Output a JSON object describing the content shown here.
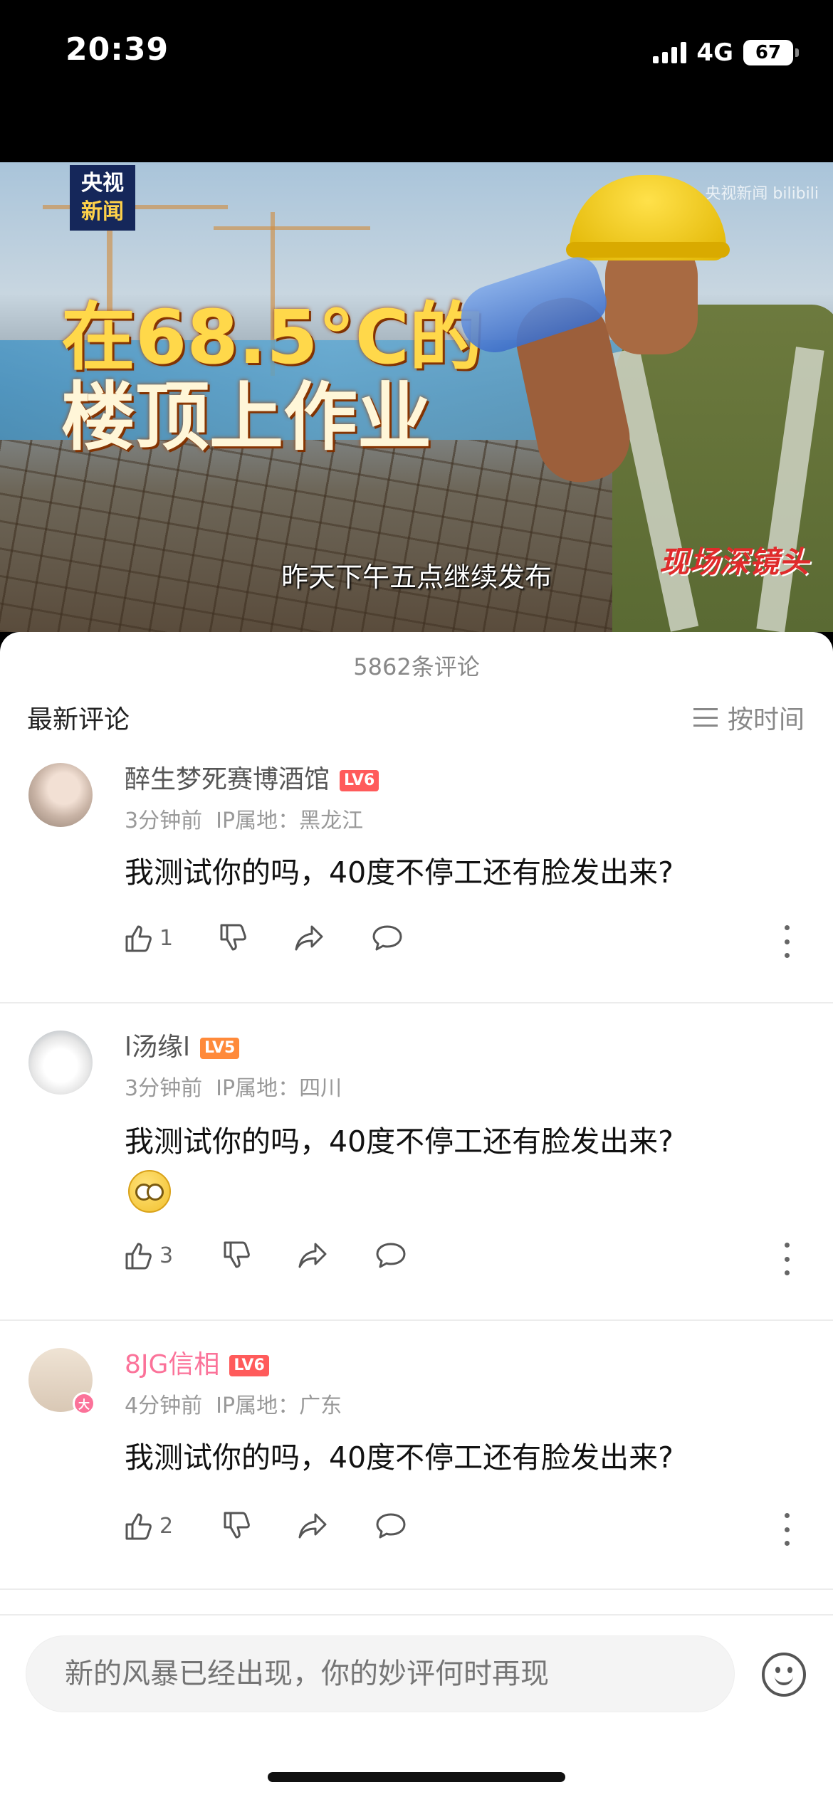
{
  "status_bar": {
    "time": "20:39",
    "network": "4G",
    "battery": "67"
  },
  "video": {
    "logo_line1": "央视",
    "logo_line2": "新闻",
    "watermark": "央视新闻 bilibili",
    "headline_line1": "在68.5°C的",
    "headline_line2": "楼顶上作业",
    "subtitle": "昨天下午五点继续发布",
    "corner_logo": "现场深镜头"
  },
  "comments_panel": {
    "count": "5862条评论",
    "section_title": "最新评论",
    "sort_label": "按时间"
  },
  "comments": [
    {
      "username": "醉生梦死赛博酒馆",
      "level": "LV6",
      "time": "3分钟前",
      "location": "IP属地：黑龙江",
      "text": "我测试你的吗，40度不停工还有脸发出来?",
      "likes": "1"
    },
    {
      "username": "l汤缘l",
      "level": "LV5",
      "time": "3分钟前",
      "location": "IP属地：四川",
      "text": "我测试你的吗，40度不停工还有脸发出来?",
      "emoji": "dazed-emoji",
      "likes": "3"
    },
    {
      "username": "8JG信相",
      "level": "LV6",
      "avatar_badge": "大",
      "time": "4分钟前",
      "location": "IP属地：广东",
      "text": "我测试你的吗，40度不停工还有脸发出来?",
      "likes": "2"
    }
  ],
  "input": {
    "placeholder": "新的风暴已经出现，你的妙评何时再现"
  },
  "colors": {
    "accent_pink": "#fb7299",
    "level6": "#ff5b5b",
    "level5": "#ff8a3a"
  }
}
